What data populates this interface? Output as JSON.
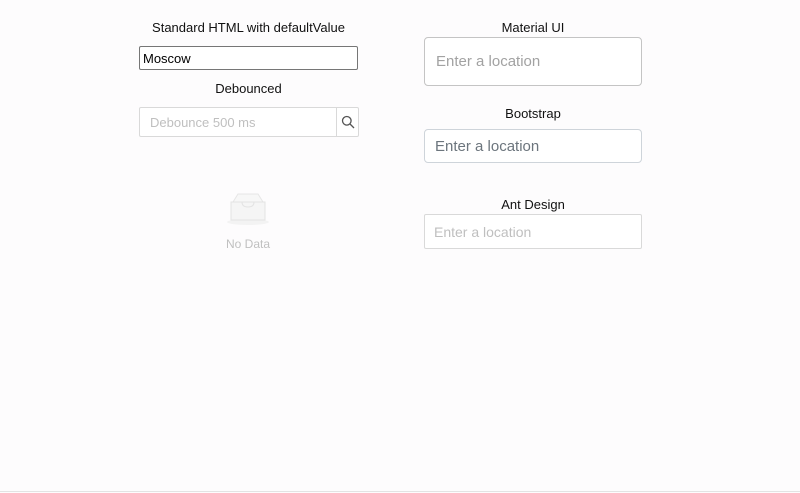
{
  "standard": {
    "label": "Standard HTML with defaultValue",
    "value": "Moscow"
  },
  "debounced": {
    "label": "Debounced",
    "placeholder": "Debounce 500 ms",
    "search_icon": "search-icon"
  },
  "empty": {
    "text": "No Data",
    "icon": "inbox-icon"
  },
  "material": {
    "label": "Material UI",
    "placeholder": "Enter a location"
  },
  "bootstrap": {
    "label": "Bootstrap",
    "placeholder": "Enter a location"
  },
  "ant": {
    "label": "Ant Design",
    "placeholder": "Enter a location"
  }
}
